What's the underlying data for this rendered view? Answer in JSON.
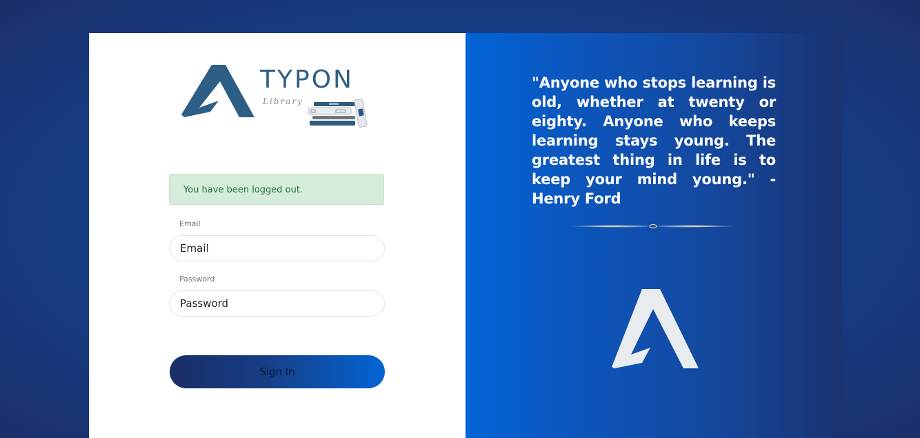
{
  "brand": {
    "name": "TYPON",
    "subtitle": "Library"
  },
  "alert": {
    "message": "You have been logged out."
  },
  "form": {
    "email_label": "Email",
    "email_placeholder": "Email",
    "password_label": "Password",
    "password_placeholder": "Password",
    "submit_label": "Sign In"
  },
  "quote": {
    "text": "\"Anyone who stops learning is old, whether at twenty or eighty. Anyone who keeps learning stays young. The greatest thing in life is to keep your mind young.\" -Henry Ford"
  },
  "colors": {
    "brand_blue": "#2d5f86",
    "alert_bg": "#d4ecd9",
    "alert_text": "#27703a",
    "panel_gradient_start": "#0264d6",
    "panel_gradient_end": "#1a3370"
  },
  "icons": [
    "typon-logo-icon",
    "books-icon",
    "ornament-divider-icon",
    "typon-mark-icon"
  ]
}
